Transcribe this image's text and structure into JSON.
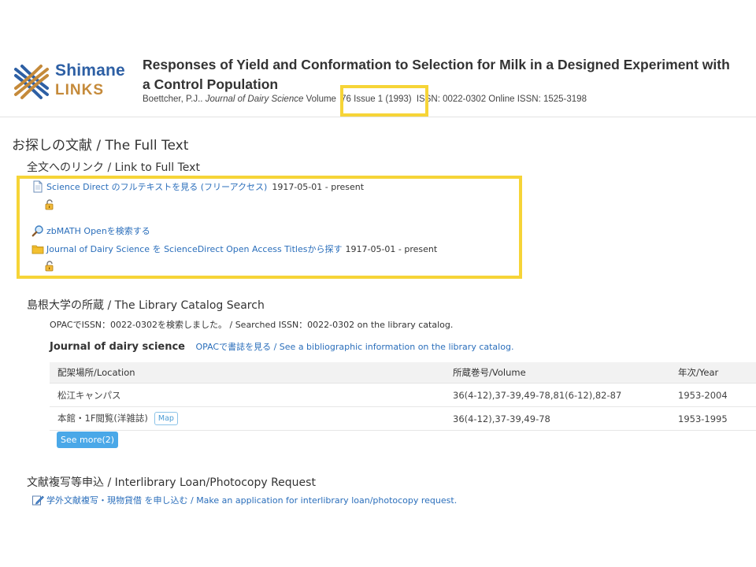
{
  "logo": {
    "line1": "Shimane",
    "line2": "LINKS"
  },
  "article": {
    "title": "Responses of Yield and Conformation to Selection for Milk in a Designed Experiment with a Control Population",
    "authors": "Boettcher, P.J..",
    "journal": "Journal of Dairy Science",
    "volume_prefix": "Volume",
    "volume_issue": "76 Issue 1 (1993)",
    "issn": "ISSN: 0022-0302",
    "online_issn": "Online ISSN: 1525-3198"
  },
  "full_text": {
    "heading": "お探しの文献 / The Full Text",
    "subheading": "全文へのリンク / Link to Full Text",
    "links": [
      {
        "label": "Science Direct のフルテキストを見る (フリーアクセス)",
        "date": "1917-05-01 - present",
        "icon": "document-icon"
      },
      {
        "label": "zbMATH Openを検索する",
        "date": "",
        "icon": "magnifier-icon"
      },
      {
        "label": "Journal of Dairy Science を ScienceDirect Open Access Titlesから探す",
        "date": "1917-05-01 - present",
        "icon": "folder-icon"
      }
    ]
  },
  "catalog": {
    "heading": "島根大学の所蔵 / The Library Catalog Search",
    "searched_text": "OPACでISSN：0022-0302を検索しました。 / Searched ISSN：0022-0302 on the library catalog.",
    "journal_title": "Journal of dairy science",
    "opac_link": "OPACで書誌を見る / See a bibliographic information on the library catalog.",
    "columns": [
      "配架場所/Location",
      "所蔵巻号/Volume",
      "年次/Year"
    ],
    "rows": [
      {
        "location": "松江キャンパス",
        "volume": "36(4-12),37-39,49-78,81(6-12),82-87",
        "year": "1953-2004",
        "map": ""
      },
      {
        "location": "本館・1F閲覧(洋雑誌)",
        "volume": "36(4-12),37-39,49-78",
        "year": "1953-1995",
        "map": "Map"
      }
    ],
    "see_more": "See more(2)"
  },
  "ill": {
    "heading": "文献複写等申込 / Interlibrary Loan/Photocopy Request",
    "link": "学外文献複写・現物貸借 を申し込む / Make an application for interlibrary loan/photocopy request."
  },
  "colors": {
    "highlight": "#f6d437",
    "link": "#2a6ebb",
    "logo_blue": "#2d5fa4",
    "logo_gold": "#c58a3a"
  }
}
